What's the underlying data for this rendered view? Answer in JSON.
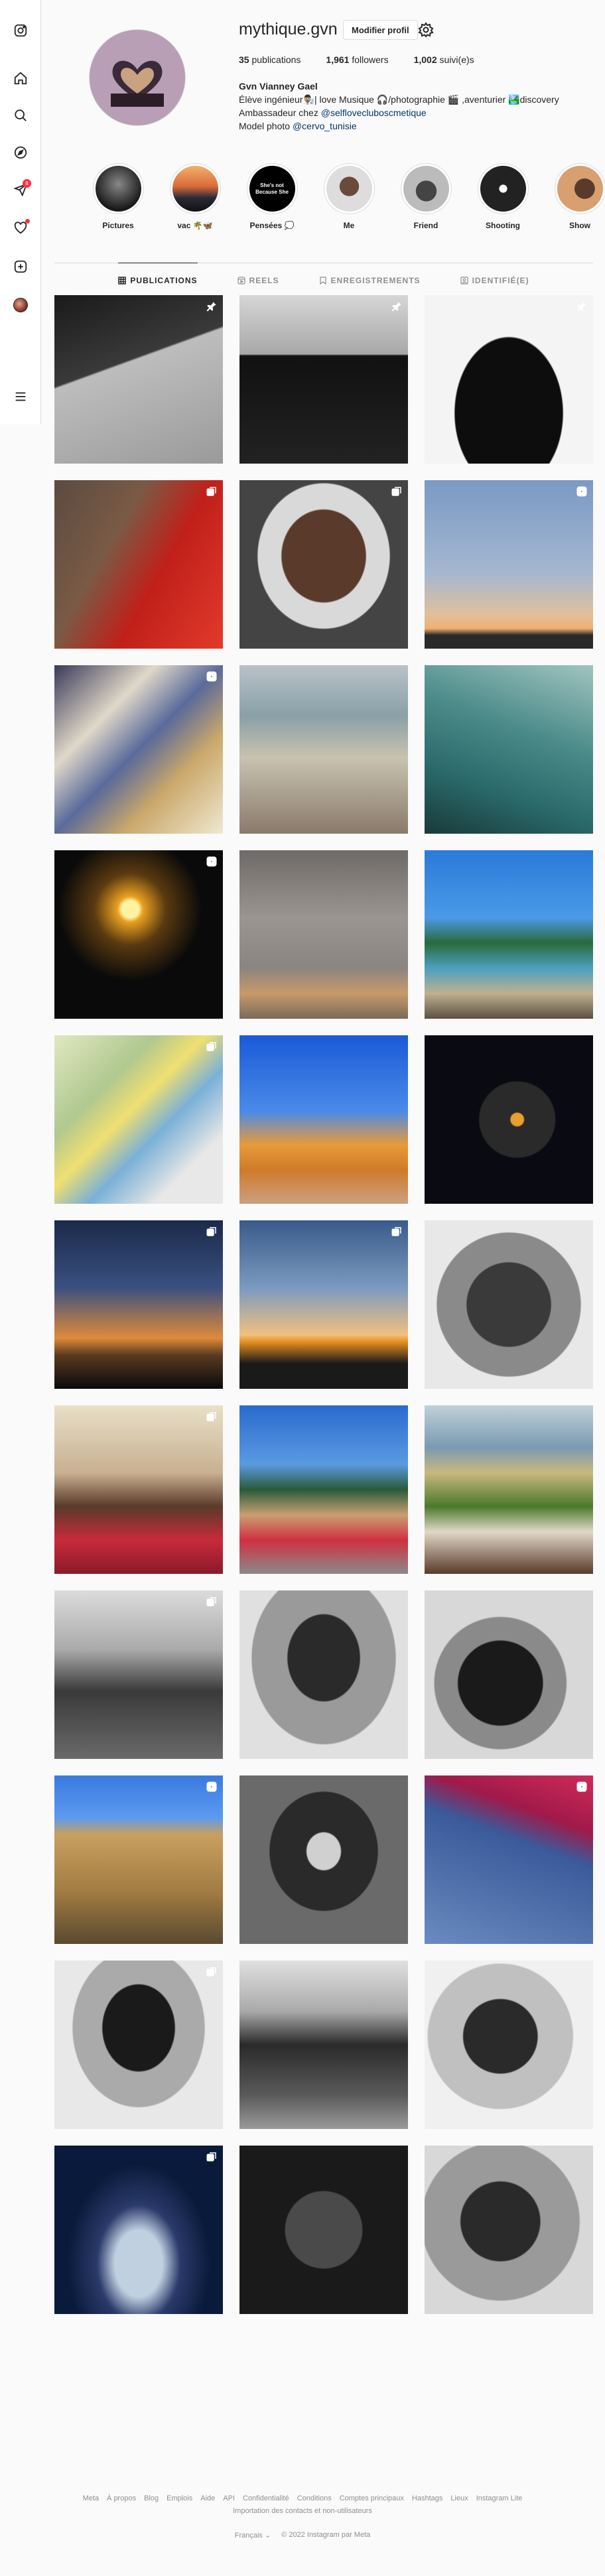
{
  "nav": {
    "icons": [
      "instagram-icon",
      "home-icon",
      "search-icon",
      "explore-icon",
      "messenger-icon",
      "heart-icon",
      "create-icon",
      "avatar",
      "menu-icon"
    ],
    "messages_badge": "8"
  },
  "profile": {
    "username": "mythique.gvn",
    "edit_label": "Modifier profil",
    "stats": {
      "posts_count": "35",
      "posts_label": "publications",
      "followers_count": "1,961",
      "followers_label": "followers",
      "following_count": "1,002",
      "following_label": "suivi(e)s"
    },
    "bio": {
      "name": "Gvn Vianney Gael",
      "line1": "Élève ingénieur👨🏾‍🔬| love Musique 🎧/photographie 🎬 ,aventurier 🏞️discovery",
      "line2_prefix": "Ambassadeur chez ",
      "line2_tag": "@selflovecluboscmetique",
      "line3_prefix": "Model photo ",
      "line3_tag": "@cervo_tunisie"
    }
  },
  "highlights": [
    {
      "label": "Pictures"
    },
    {
      "label": "vac 🌴🦋"
    },
    {
      "label": "Pensées 💭",
      "inner_text": "She's not Because She"
    },
    {
      "label": "Me"
    },
    {
      "label": "Friend"
    },
    {
      "label": "Shooting"
    },
    {
      "label": "Show"
    }
  ],
  "tabs": [
    {
      "label": "PUBLICATIONS",
      "active": true,
      "icon": "grid-icon"
    },
    {
      "label": "REELS",
      "active": false,
      "icon": "reels-icon"
    },
    {
      "label": "ENREGISTREMENTS",
      "active": false,
      "icon": "bookmark-icon"
    },
    {
      "label": "IDENTIFIÉ(E)",
      "active": false,
      "icon": "tag-icon"
    }
  ],
  "footer": {
    "links": [
      "Meta",
      "À propos",
      "Blog",
      "Emplois",
      "Aide",
      "API",
      "Confidentialité",
      "Conditions",
      "Comptes principaux",
      "Hashtags",
      "Lieux",
      "Instagram Lite",
      "Importation des contacts et non-utilisateurs"
    ],
    "language": "Français",
    "copyright": "© 2022 Instagram par Meta"
  }
}
